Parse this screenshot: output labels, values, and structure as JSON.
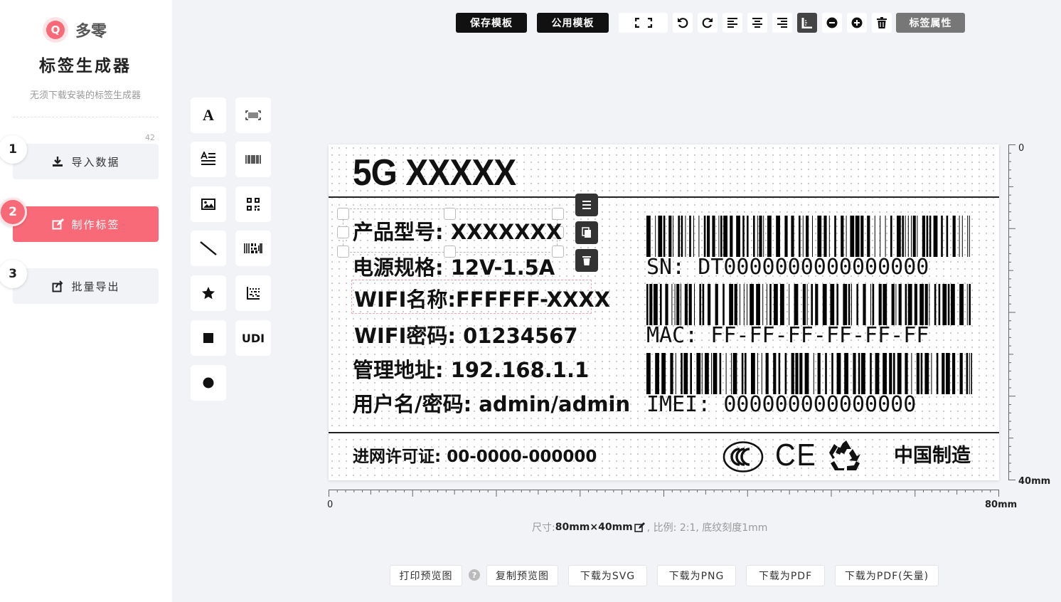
{
  "brand": {
    "logo_letter": "Q",
    "name": "多零",
    "title": "标签生成器",
    "subtitle": "无须下载安装的标签生成器",
    "count": "42"
  },
  "steps": [
    {
      "num": "1",
      "label": "导入数据"
    },
    {
      "num": "2",
      "label": "制作标签"
    },
    {
      "num": "3",
      "label": "批量导出"
    }
  ],
  "toolbar": {
    "save_template": "保存模板",
    "public_template": "公用模板",
    "label_props": "标签属性"
  },
  "tools": {
    "udi": "UDI"
  },
  "label": {
    "title": "5G XXXXX",
    "lines": [
      "产品型号: XXXXXXX",
      "电源规格: 12V-1.5A",
      "WIFI名称:FFFFFF-XXXX",
      "WIFI密码: 01234567",
      "管理地址: 192.168.1.1",
      "用户名/密码: admin/admin"
    ],
    "sn": "SN: DT0000000000000000",
    "mac": "MAC: FF-FF-FF-FF-FF-FF",
    "imei": "IMEI: 000000000000000",
    "license": "进网许可证: 00-0000-000000",
    "made_in": "中国制造",
    "ce": "CE"
  },
  "rulers": {
    "x_start": "0",
    "x_end": "80mm",
    "y_start": "0",
    "y_end": "40mm"
  },
  "size_info": {
    "prefix": "尺寸: ",
    "size": "80mm×40mm",
    "rest": ", 比例: 2:1, 底纹刻度1mm"
  },
  "bottom": {
    "print_preview": "打印预览图",
    "help": "?",
    "copy_preview": "复制预览图",
    "svg": "下载为SVG",
    "png": "下载为PNG",
    "pdf": "下载为PDF",
    "pdf_vector": "下载为PDF(矢量)"
  }
}
